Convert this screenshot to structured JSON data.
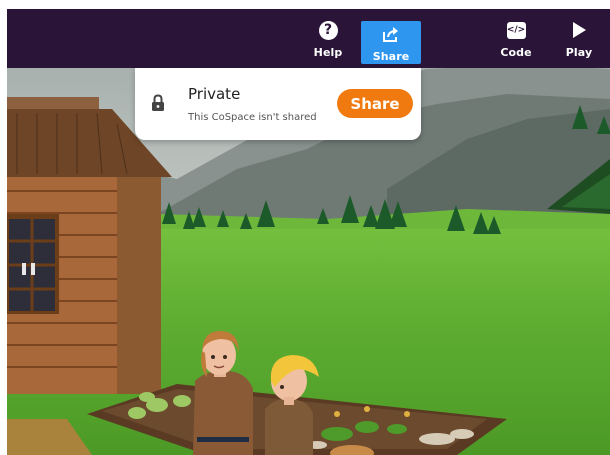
{
  "toolbar": {
    "help_label": "Help",
    "share_label": "Share",
    "code_label": "Code",
    "play_label": "Play",
    "help_glyph": "?",
    "code_glyph": "</>",
    "active_color": "#2f96f0",
    "background_color": "#2a1538"
  },
  "share_popup": {
    "status_title": "Private",
    "status_text": "This CoSpace isn't shared",
    "share_button_label": "Share",
    "share_button_color": "#f07a10",
    "icon": "lock-icon"
  },
  "scene": {
    "description_icons": [
      "log-cabin",
      "pine-trees",
      "girl-character",
      "boy-character",
      "garden-bed",
      "mountains"
    ]
  }
}
